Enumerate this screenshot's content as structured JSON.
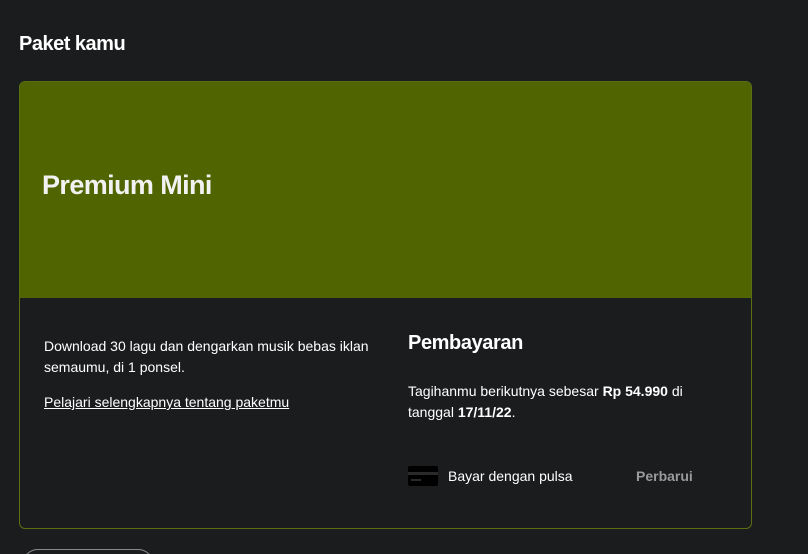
{
  "section": {
    "title": "Paket kamu"
  },
  "plan": {
    "name": "Premium Mini",
    "description": "Download 30 lagu dan dengarkan musik bebas iklan semaumu, di 1 ponsel.",
    "learn_more_link": "Pelajari selengkapnya tentang paketmu"
  },
  "payment": {
    "title": "Pembayaran",
    "next_bill_prefix": "Tagihanmu berikutnya sebesar ",
    "amount": "Rp 54.990",
    "next_bill_middle": " di tanggal ",
    "date": "17/11/22",
    "next_bill_suffix": ".",
    "method_icon": "card-icon",
    "method_label": "Bayar dengan pulsa",
    "renew_label": "Perbarui"
  },
  "colors": {
    "background": "#1b1c1e",
    "plan_header": "#506502",
    "card_border": "#5b6e12",
    "muted_button_text": "#9a9a9a"
  }
}
